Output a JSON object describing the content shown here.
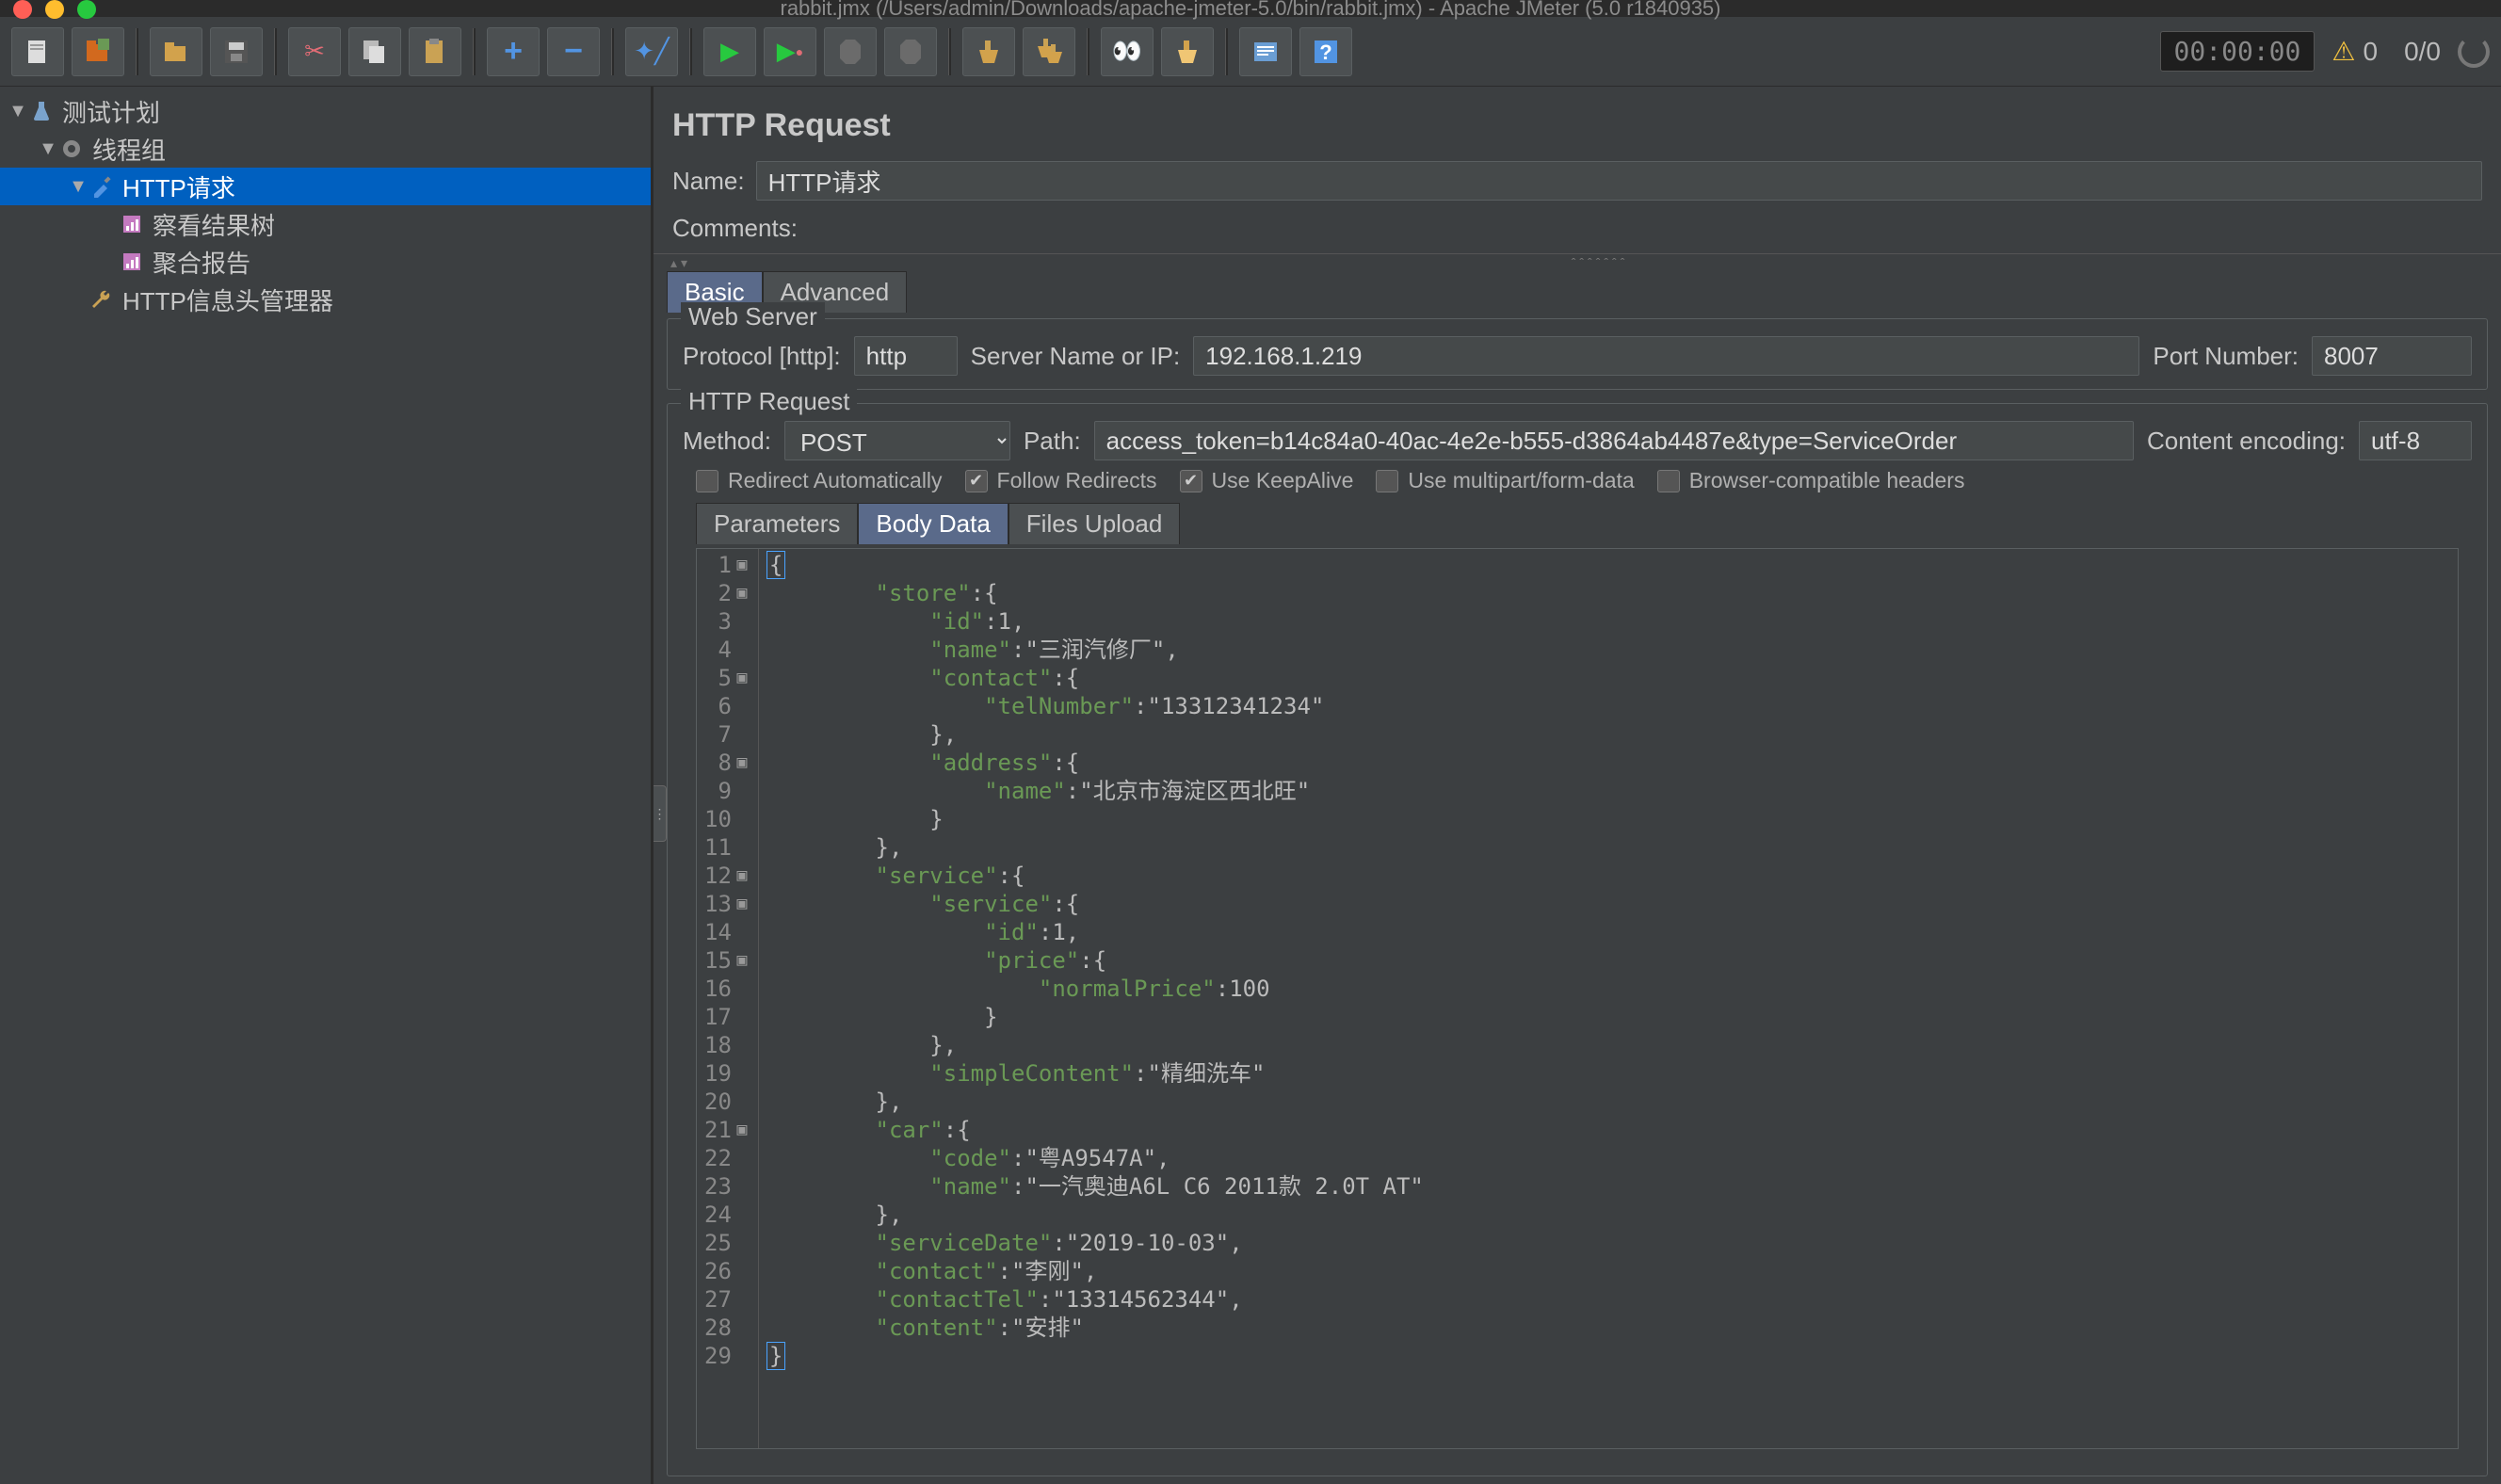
{
  "window": {
    "title": "rabbit.jmx (/Users/admin/Downloads/apache-jmeter-5.0/bin/rabbit.jmx) - Apache JMeter (5.0 r1840935)"
  },
  "toolbar": {
    "timer": "00:00:00",
    "warnings": "0",
    "counts": "0/0"
  },
  "tree": {
    "items": [
      {
        "label": "测试计划",
        "indent": 0,
        "icon": "flask",
        "expanded": true
      },
      {
        "label": "线程组",
        "indent": 1,
        "icon": "gear",
        "expanded": true
      },
      {
        "label": "HTTP请求",
        "indent": 2,
        "icon": "eyedrop",
        "expanded": true,
        "selected": true
      },
      {
        "label": "察看结果树",
        "indent": 3,
        "icon": "report"
      },
      {
        "label": "聚合报告",
        "indent": 3,
        "icon": "report"
      },
      {
        "label": "HTTP信息头管理器",
        "indent": 2,
        "icon": "wrench"
      }
    ]
  },
  "panel": {
    "title": "HTTP Request",
    "name_label": "Name:",
    "name_value": "HTTP请求",
    "comments_label": "Comments:",
    "comments_value": "",
    "tabs": {
      "basic": "Basic",
      "advanced": "Advanced"
    },
    "webserver": {
      "group": "Web Server",
      "protocol_label": "Protocol [http]:",
      "protocol_value": "http",
      "server_label": "Server Name or IP:",
      "server_value": "192.168.1.219",
      "port_label": "Port Number:",
      "port_value": "8007"
    },
    "httprequest": {
      "group": "HTTP Request",
      "method_label": "Method:",
      "method_value": "POST",
      "path_label": "Path:",
      "path_value": "access_token=b14c84a0-40ac-4e2e-b555-d3864ab4487e&type=ServiceOrder",
      "encoding_label": "Content encoding:",
      "encoding_value": "utf-8",
      "checks": {
        "redirect_auto": "Redirect Automatically",
        "follow_redirects": "Follow Redirects",
        "keepalive": "Use KeepAlive",
        "multipart": "Use multipart/form-data",
        "browser_compat": "Browser-compatible headers"
      }
    },
    "bodytabs": {
      "params": "Parameters",
      "body": "Body Data",
      "files": "Files Upload"
    },
    "body_lines": [
      "{",
      "        \"store\":{",
      "            \"id\":1,",
      "            \"name\":\"三润汽修厂\",",
      "            \"contact\":{",
      "                \"telNumber\":\"13312341234\"",
      "            },",
      "            \"address\":{",
      "                \"name\":\"北京市海淀区西北旺\"",
      "            }",
      "        },",
      "        \"service\":{",
      "            \"service\":{",
      "                \"id\":1,",
      "                \"price\":{",
      "                    \"normalPrice\":100",
      "                }",
      "            },",
      "            \"simpleContent\":\"精细洗车\"",
      "        },",
      "        \"car\":{",
      "            \"code\":\"粤A9547A\",",
      "            \"name\":\"一汽奥迪A6L C6 2011款 2.0T AT\"",
      "        },",
      "        \"serviceDate\":\"2019-10-03\",",
      "        \"contact\":\"李刚\",",
      "        \"contactTel\":\"13314562344\",",
      "        \"content\":\"安排\"",
      "}"
    ]
  }
}
